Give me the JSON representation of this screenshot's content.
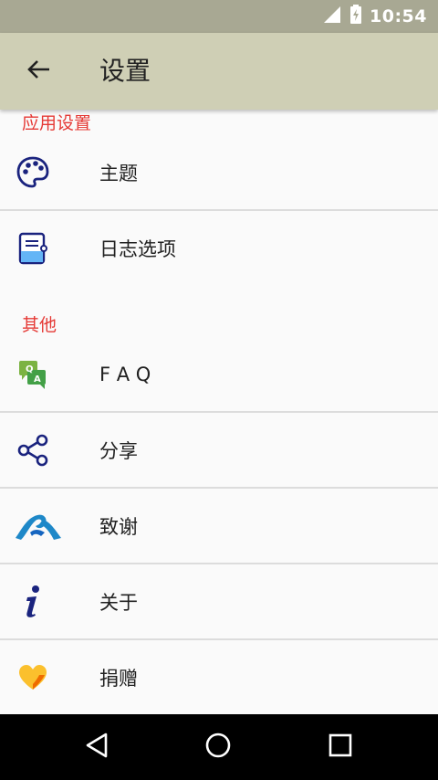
{
  "status_bar": {
    "time": "10:54",
    "icons": [
      "signal-icon",
      "battery-charging-icon"
    ]
  },
  "app_bar": {
    "title": "设置",
    "back_icon": "arrow-left-icon"
  },
  "sections": [
    {
      "header": "应用设置",
      "items": [
        {
          "label": "主题",
          "icon": "palette-icon"
        },
        {
          "label": "日志选项",
          "icon": "notebook-icon"
        }
      ]
    },
    {
      "header": "其他",
      "items": [
        {
          "label": "F A Q",
          "icon": "qa-chat-icon"
        },
        {
          "label": "分享",
          "icon": "share-icon"
        },
        {
          "label": "致谢",
          "icon": "handshake-icon"
        },
        {
          "label": "关于",
          "icon": "info-icon"
        },
        {
          "label": "捐赠",
          "icon": "heart-hand-icon"
        }
      ]
    }
  ],
  "colors": {
    "status_bar": "#a8a893",
    "app_bar": "#cfcfb5",
    "section_header": "#e53935",
    "icon_navy": "#1a237e",
    "icon_blue": "#1e88c8"
  },
  "nav_bar": {
    "icons": [
      "back-triangle-icon",
      "home-circle-icon",
      "recents-square-icon"
    ]
  }
}
